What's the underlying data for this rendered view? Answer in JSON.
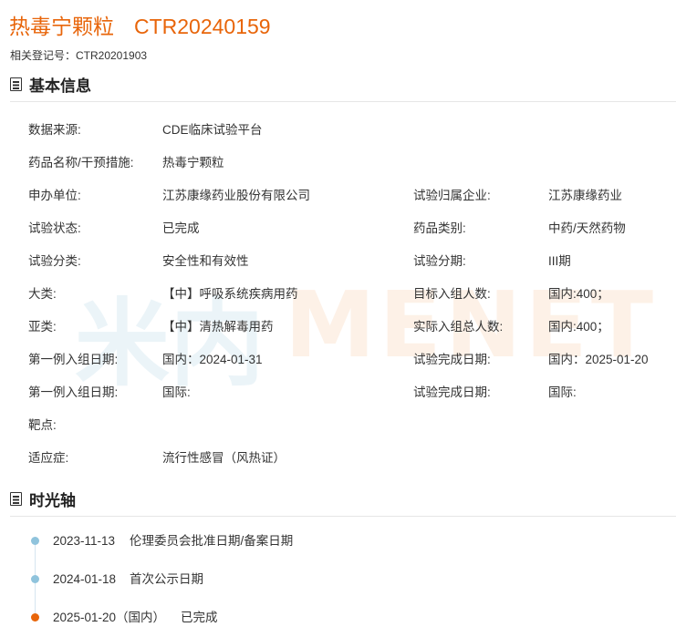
{
  "header": {
    "drug_name": "热毒宁颗粒",
    "trial_code": "CTR20240159",
    "related_reg": "相关登记号：CTR20201903"
  },
  "sections": {
    "basic_info": "基本信息",
    "timeline": "时光轴"
  },
  "info": {
    "data_source": {
      "label": "数据来源:",
      "value": "CDE临床试验平台"
    },
    "drug_name": {
      "label": "药品名称/干预措施:",
      "value": "热毒宁颗粒"
    },
    "applicant": {
      "label": "申办单位:",
      "value": "江苏康缘药业股份有限公司"
    },
    "trial_company": {
      "label": "试验归属企业:",
      "value": "江苏康缘药业"
    },
    "status": {
      "label": "试验状态:",
      "value": "已完成"
    },
    "drug_category": {
      "label": "药品类别:",
      "value": "中药/天然药物"
    },
    "trial_class": {
      "label": "试验分类:",
      "value": "安全性和有效性"
    },
    "phase": {
      "label": "试验分期:",
      "value": "III期"
    },
    "major_class": {
      "label": "大类:",
      "value": "【中】呼吸系统疾病用药"
    },
    "target_enroll": {
      "label": "目标入组人数:",
      "value": "国内:400；"
    },
    "sub_class": {
      "label": "亚类:",
      "value": "【中】清热解毒用药"
    },
    "actual_enroll": {
      "label": "实际入组总人数:",
      "value": "国内:400；"
    },
    "first_enroll_dom": {
      "label": "第一例入组日期:",
      "value": "国内：2024-01-31"
    },
    "complete_dom": {
      "label": "试验完成日期:",
      "value": "国内：2025-01-20"
    },
    "first_enroll_intl": {
      "label": "第一例入组日期:",
      "value": "国际:"
    },
    "complete_intl": {
      "label": "试验完成日期:",
      "value": "国际:"
    },
    "target": {
      "label": "靶点:",
      "value": ""
    },
    "indication": {
      "label": "适应症:",
      "value": "流行性感冒（风热证）"
    }
  },
  "watermark": {
    "hanzi": "米内",
    "latin": "MENET"
  },
  "timeline": [
    {
      "date": "2023-11-13",
      "text": "伦理委员会批准日期/备案日期",
      "state": "normal"
    },
    {
      "date": "2024-01-18",
      "text": "首次公示日期",
      "state": "normal"
    },
    {
      "date": "2025-01-20（国内）",
      "text": "已完成",
      "state": "done"
    }
  ],
  "colors": {
    "accent": "#e8650a",
    "timeline_dot": "#8fc3dc"
  }
}
